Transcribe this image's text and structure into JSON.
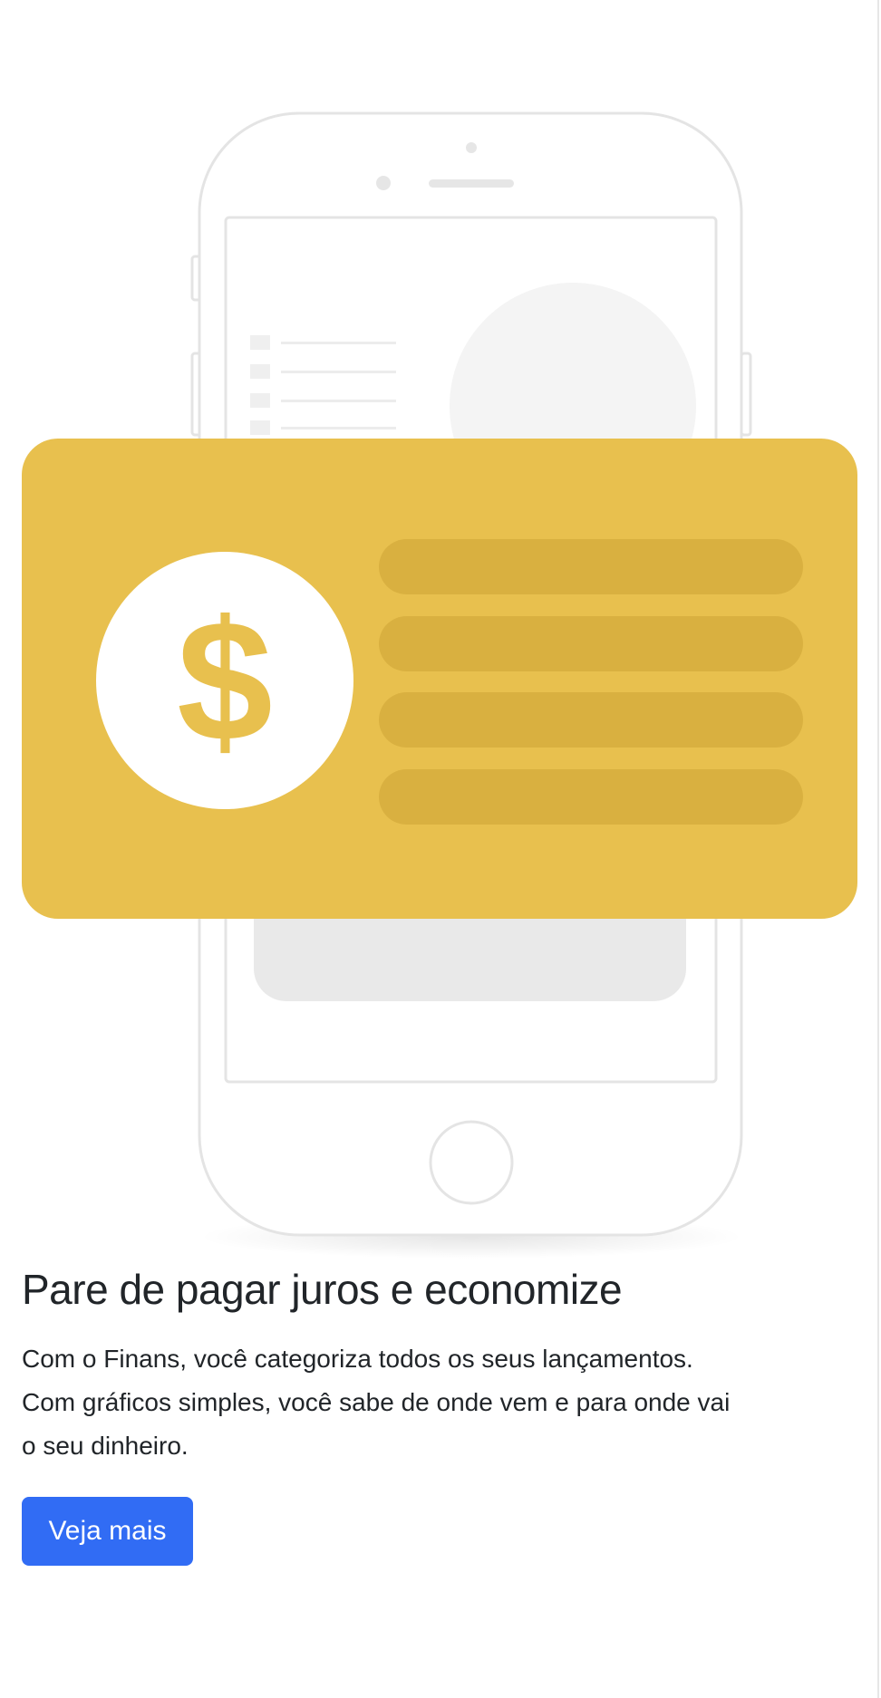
{
  "feature": {
    "title": "Pare de pagar juros e economize",
    "description_lines": [
      "Com o Finans, você categoriza todos os seus lançamentos.",
      "Com gráficos simples, você sabe de onde vem e para onde vai",
      "o seu dinheiro."
    ],
    "cta_label": "Veja mais"
  },
  "illustration": {
    "currency_symbol": "$",
    "colors": {
      "card": "#e8c04e",
      "card_lines": "#d9b040",
      "coin": "#ffffff",
      "phone_outline": "#e4e4e4",
      "accent_button": "#316cf4"
    }
  }
}
